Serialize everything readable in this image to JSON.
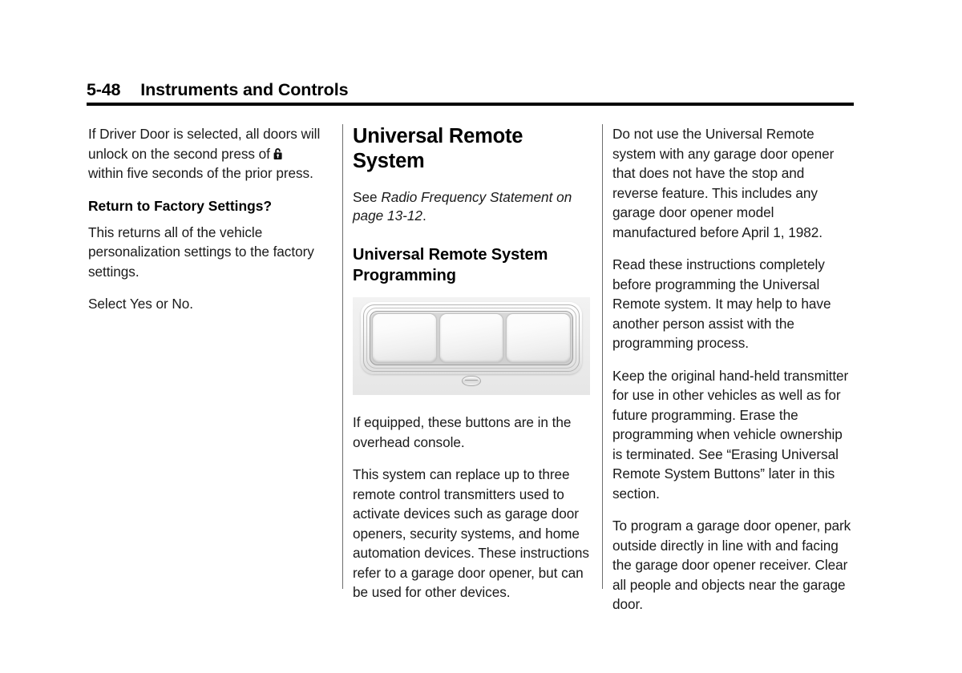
{
  "document": {
    "page_number": "5-48",
    "chapter_title": "Instruments and Controls"
  },
  "columns": {
    "left": {
      "paragraph_1_part_a": "If Driver Door is selected, all doors will unlock on the second press of",
      "lock_icon": "padlock-unlock-icon",
      "paragraph_1_part_b": "within five seconds of the prior press.",
      "heading_1": "Return to Factory Settings?",
      "paragraph_2": "This returns all of the vehicle personalization settings to the factory settings.",
      "paragraph_3": "Select Yes or No."
    },
    "middle": {
      "heading_main": "Universal Remote System",
      "xref_prefix": "See ",
      "xref_italic": "Radio Frequency Statement on page 13-12",
      "xref_suffix": ".",
      "heading_sub": "Universal Remote System Programming",
      "figure": {
        "caption_name": "overhead-console-universal-remote-buttons",
        "button_count": 3,
        "indicator": "led-indicator"
      },
      "paragraph_1": "If equipped, these buttons are in the overhead console.",
      "paragraph_2": "This system can replace up to three remote control transmitters used to activate devices such as garage door openers, security systems, and home automation devices. These instructions refer to a garage door opener, but can be used for other devices."
    },
    "right": {
      "paragraph_1": "Do not use the Universal Remote system with any garage door opener that does not have the stop and reverse feature. This includes any garage door opener model manufactured before April 1, 1982.",
      "paragraph_2": "Read these instructions completely before programming the Universal Remote system. It may help to have another person assist with the programming process.",
      "paragraph_3": "Keep the original hand-held transmitter for use in other vehicles as well as for future programming. Erase the programming when vehicle ownership is terminated. See “Erasing Universal Remote System Buttons” later in this section.",
      "paragraph_4": "To program a garage door opener, park outside directly in line with and facing the garage door opener receiver. Clear all people and objects near the garage door."
    }
  },
  "colors": {
    "page_background": "#ffffff",
    "text": "#1a1a1a",
    "rule": "#000000",
    "divider": "#6d6d6d"
  }
}
